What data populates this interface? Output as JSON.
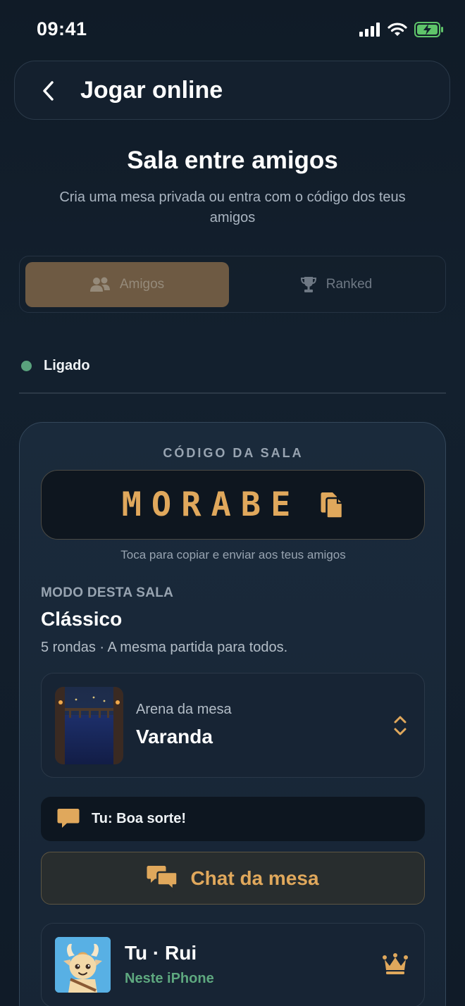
{
  "status_bar": {
    "time": "09:41",
    "icons": [
      "signal-icon",
      "wifi-icon",
      "battery-charging-icon"
    ]
  },
  "header": {
    "title": "Jogar online",
    "back_icon": "chevron-left-icon"
  },
  "page": {
    "title": "Sala entre amigos",
    "subtitle": "Cria uma mesa privada ou entra com o código dos teus amigos"
  },
  "tabs": [
    {
      "label": "Amigos",
      "icon": "people-icon",
      "active": true
    },
    {
      "label": "Ranked",
      "icon": "trophy-icon",
      "active": false
    }
  ],
  "connection": {
    "status": "Ligado",
    "color": "#5aa27d"
  },
  "room": {
    "code_caption": "CÓDIGO DA SALA",
    "code": "MORABE",
    "copy_icon": "copy-icon",
    "code_hint": "Toca para copiar e enviar aos teus amigos",
    "mode_caption": "MODO DESTA SALA",
    "mode_name": "Clássico",
    "mode_desc": "5 rondas · A mesma partida para todos.",
    "arena": {
      "caption": "Arena da mesa",
      "name": "Varanda",
      "chevron_icon": "chevron-up-down-icon"
    },
    "last_message": {
      "icon": "chat-bubble-icon",
      "text": "Tu: Boa sorte!"
    },
    "chat_button": {
      "icon": "chat-bubbles-icon",
      "label": "Chat da mesa"
    },
    "players": [
      {
        "name": "Tu · Rui",
        "device": "Neste iPhone",
        "host_icon": "crown-icon"
      }
    ]
  },
  "colors": {
    "accent": "#e0a85c",
    "background": "#111c28",
    "connected": "#5aa27d"
  }
}
